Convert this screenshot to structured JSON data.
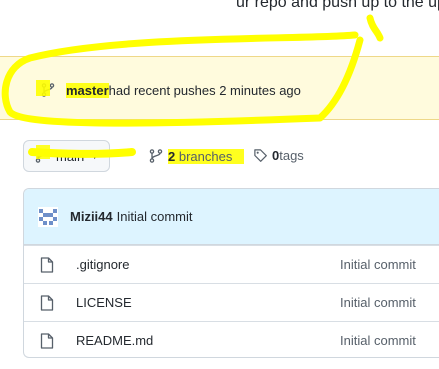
{
  "header": {
    "partial_text": "ur repo and push up to the upp"
  },
  "banner": {
    "branch_name": "master",
    "message": " had recent pushes 2 minutes ago"
  },
  "branch_selector": {
    "label": "main"
  },
  "branches": {
    "count": "2",
    "label": " branches"
  },
  "tags": {
    "count": "0",
    "label": " tags"
  },
  "commit": {
    "author": "Mizii44",
    "message": "Initial commit"
  },
  "files": [
    {
      "name": ".gitignore",
      "commit": "Initial commit"
    },
    {
      "name": "LICENSE",
      "commit": "Initial commit"
    },
    {
      "name": "README.md",
      "commit": "Initial commit"
    }
  ],
  "colors": {
    "highlight": "#ffff00",
    "banner_bg": "#fffbdd",
    "commit_bg": "#ddf4ff"
  },
  "icons": [
    "git-branch-icon",
    "tag-icon",
    "file-icon",
    "avatar-identicon"
  ]
}
